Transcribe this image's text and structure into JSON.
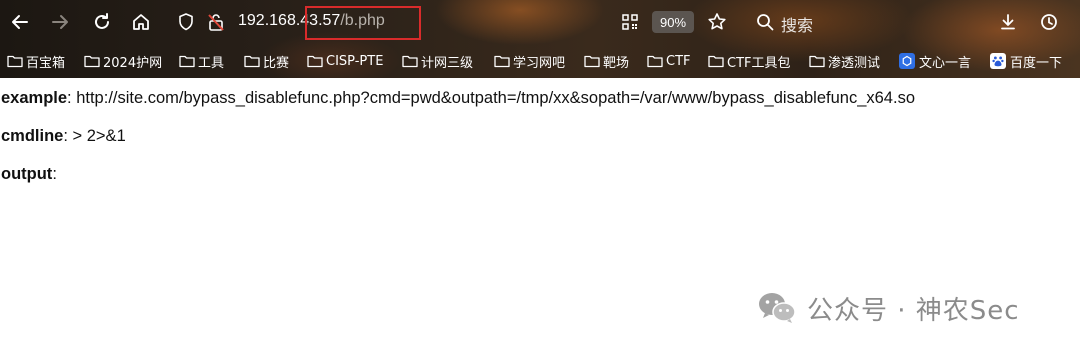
{
  "browser": {
    "url_host": "192.168.43.57",
    "url_path": "/b.php",
    "zoom": "90%",
    "search_label": "搜索"
  },
  "bookmarks": [
    {
      "label": "百宝箱",
      "icon": "folder-icon"
    },
    {
      "label": "2024护网",
      "icon": "folder-icon"
    },
    {
      "label": "工具",
      "icon": "folder-icon"
    },
    {
      "label": "比赛",
      "icon": "folder-icon"
    },
    {
      "label": "CISP-PTE",
      "icon": "folder-icon"
    },
    {
      "label": "计网三级",
      "icon": "folder-icon"
    },
    {
      "label": "学习网吧",
      "icon": "folder-icon"
    },
    {
      "label": "靶场",
      "icon": "folder-icon"
    },
    {
      "label": "CTF",
      "icon": "folder-icon"
    },
    {
      "label": "CTF工具包",
      "icon": "folder-icon"
    },
    {
      "label": "渗透测试",
      "icon": "folder-icon"
    },
    {
      "label": "文心一言",
      "icon": "wenxin-icon"
    },
    {
      "label": "百度一下",
      "icon": "baidu-paw-icon"
    }
  ],
  "page": {
    "example_label": "example",
    "example_value": ": http://site.com/bypass_disablefunc.php?cmd=pwd&outpath=/tmp/xx&sopath=/var/www/bypass_disablefunc_x64.so",
    "cmdline_label": "cmdline",
    "cmdline_value": ": > 2>&1",
    "output_label": "output",
    "output_value": ":"
  },
  "watermark": {
    "text": "公众号 · 神农Sec"
  },
  "colors": {
    "highlight_box": "#d92b2b",
    "zoom_badge": "#5b5550",
    "wenxin_icon": "#2f6fe4",
    "baidu_icon": "#2a5bd7"
  }
}
